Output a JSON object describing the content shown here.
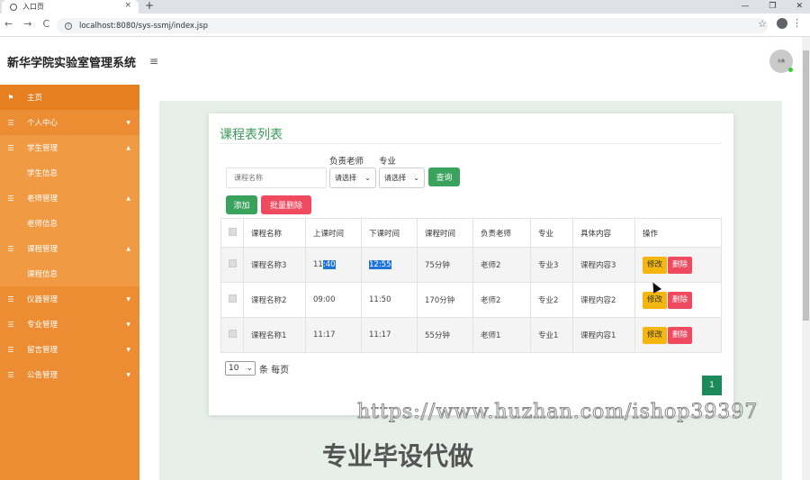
{
  "browser": {
    "tab_title": "入口页",
    "tab_close": "×",
    "new_tab": "+",
    "url": "localhost:8080/sys-ssmj/index.jsp",
    "window_controls": [
      "—",
      "❐",
      "✕"
    ],
    "nav": [
      "←",
      "→",
      "C"
    ]
  },
  "header": {
    "title": "新华学院实验室管理系统",
    "menu_icon": "≡",
    "avatar_text": "头像"
  },
  "sidebar": {
    "items": [
      {
        "label": "主页",
        "icon": "flag-icon",
        "glyph": "⚑",
        "type": "top"
      },
      {
        "label": "个人中心",
        "icon": "list-icon",
        "glyph": "☰",
        "type": "group"
      },
      {
        "label": "学生管理",
        "icon": "list-icon",
        "glyph": "☰",
        "type": "group-open"
      },
      {
        "label": "学生信息",
        "type": "child"
      },
      {
        "label": "老师管理",
        "icon": "list-icon",
        "glyph": "☰",
        "type": "group-open"
      },
      {
        "label": "老师信息",
        "type": "child"
      },
      {
        "label": "课程管理",
        "icon": "list-icon",
        "glyph": "☰",
        "type": "group-open"
      },
      {
        "label": "课程信息",
        "type": "child"
      },
      {
        "label": "仪器管理",
        "icon": "list-icon",
        "glyph": "☰",
        "type": "group"
      },
      {
        "label": "专业管理",
        "icon": "list-icon",
        "glyph": "☰",
        "type": "group"
      },
      {
        "label": "留言管理",
        "icon": "list-icon",
        "glyph": "☰",
        "type": "group"
      },
      {
        "label": "公告管理",
        "icon": "list-icon",
        "glyph": "☰",
        "type": "group"
      }
    ]
  },
  "card": {
    "title": "课程表列表",
    "filter_teacher_label": "负责老师",
    "filter_major_label": "专业",
    "search_placeholder": "课程名称",
    "teacher_select": "请选择",
    "major_select": "请选择",
    "query_button": "查询",
    "add_button": "添加",
    "batch_delete_button": "批量删除"
  },
  "table": {
    "headers": [
      "课程名称",
      "上课时间",
      "下课时间",
      "课程时间",
      "负责老师",
      "专业",
      "具体内容",
      "操作"
    ],
    "rows": [
      {
        "name": "课程名称3",
        "start_a": "11",
        "start_b": ":40",
        "end": "12:55",
        "duration": "75分钟",
        "teacher": "老师2",
        "major": "专业3",
        "content": "课程内容3"
      },
      {
        "name": "课程名称2",
        "start_a": "09:00",
        "start_b": "",
        "end": "11:50",
        "duration": "170分钟",
        "teacher": "老师2",
        "major": "专业2",
        "content": "课程内容2"
      },
      {
        "name": "课程名称1",
        "start_a": "11:17",
        "start_b": "",
        "end": "11:17",
        "duration": "55分钟",
        "teacher": "老师1",
        "major": "专业1",
        "content": "课程内容1"
      }
    ],
    "edit_label": "修改",
    "delete_label": "删除"
  },
  "pager": {
    "page_size": "10",
    "page_size_suffix": "条 每页",
    "current_page": "1"
  },
  "watermark": {
    "url": "https://www.huzhan.com/ishop39397",
    "text": "专业毕设代做"
  }
}
